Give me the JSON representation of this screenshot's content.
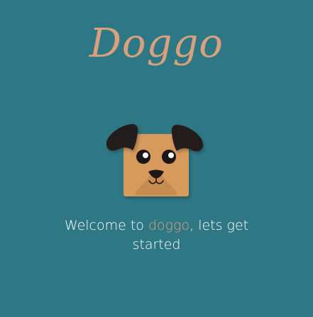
{
  "app": {
    "logo_text": "Doggo"
  },
  "welcome": {
    "prefix": "Welcome to ",
    "brand": "doggo",
    "suffix": ", lets get started"
  },
  "mascot": {
    "icon": "dog-face-icon"
  },
  "colors": {
    "background": "#2e7885",
    "accent": "#d9a07e",
    "dog_face": "#d59a5c",
    "dog_ears": "#231b1e",
    "text": "#ffffff"
  }
}
